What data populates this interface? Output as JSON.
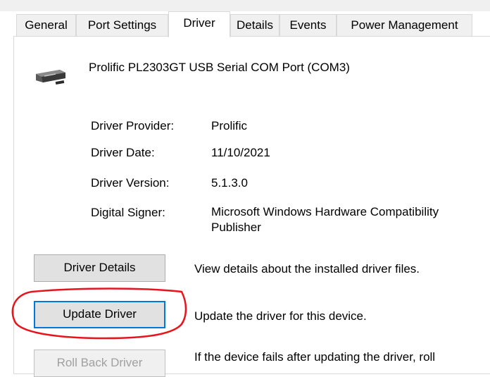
{
  "tabs": [
    {
      "label": "General"
    },
    {
      "label": "Port Settings"
    },
    {
      "label": "Driver"
    },
    {
      "label": "Details"
    },
    {
      "label": "Events"
    },
    {
      "label": "Power Management"
    }
  ],
  "active_tab": "Driver",
  "device": {
    "name": "Prolific PL2303GT USB Serial COM Port (COM3)",
    "icon": "usb-serial-port-icon"
  },
  "properties": {
    "provider_label": "Driver Provider:",
    "provider_value": "Prolific",
    "date_label": "Driver Date:",
    "date_value": "11/10/2021",
    "version_label": "Driver Version:",
    "version_value": "5.1.3.0",
    "signer_label": "Digital Signer:",
    "signer_value": "Microsoft Windows Hardware Compatibility Publisher"
  },
  "actions": {
    "driver_details_label": "Driver Details",
    "driver_details_desc": "View details about the installed driver files.",
    "update_driver_label": "Update Driver",
    "update_driver_desc": "Update the driver for this device.",
    "roll_back_label": "Roll Back Driver",
    "roll_back_desc": "If the device fails after updating the driver, roll"
  },
  "colors": {
    "focus_border": "#0078d7",
    "annotation": "#e8141c",
    "button_face": "#e1e1e1"
  }
}
